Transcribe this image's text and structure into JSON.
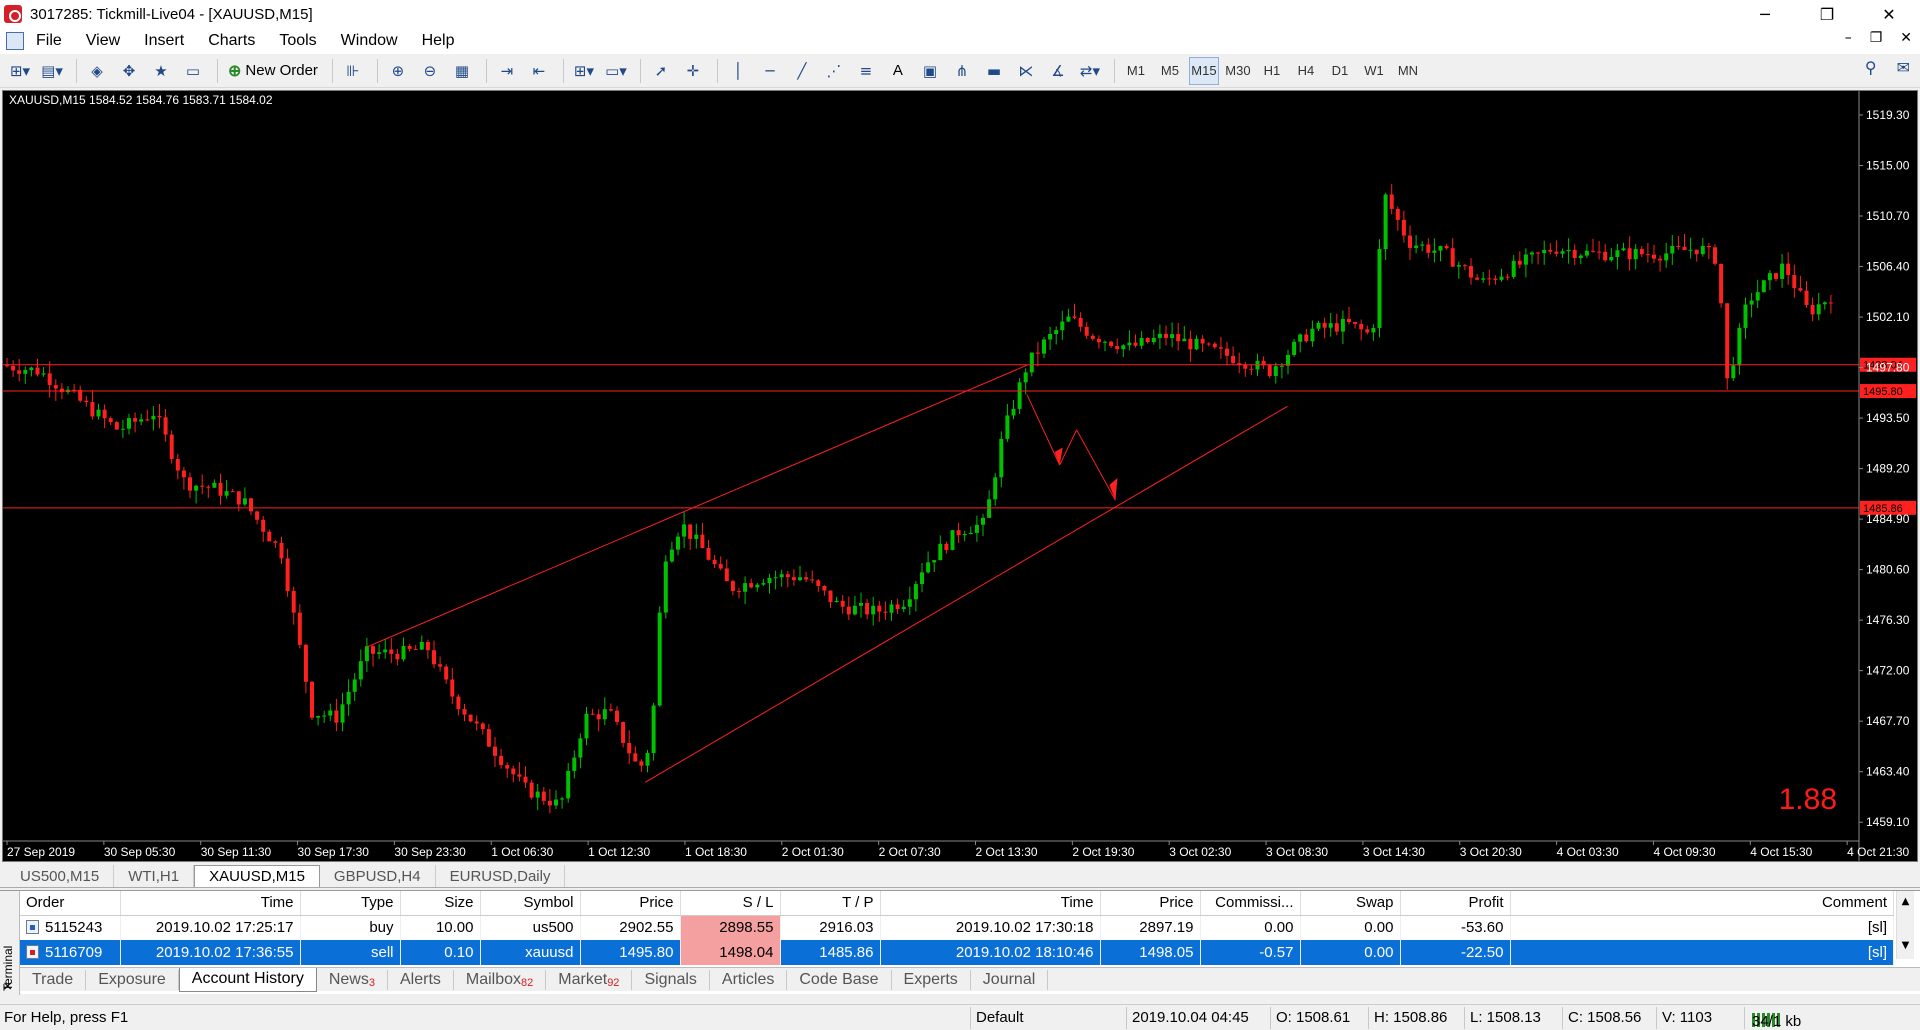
{
  "window": {
    "title": "3017285: Tickmill-Live04 - [XAUUSD,M15]",
    "controls": [
      "─",
      "❐",
      "✕"
    ]
  },
  "menu": {
    "items": [
      "File",
      "View",
      "Insert",
      "Charts",
      "Tools",
      "Window",
      "Help"
    ],
    "mdi_controls": [
      "–",
      "❐",
      "✕"
    ]
  },
  "toolbar": {
    "new_order_label": "New Order",
    "text_tool_label": "A",
    "timeframes": [
      "M1",
      "M5",
      "M15",
      "M30",
      "H1",
      "H4",
      "D1",
      "W1",
      "MN"
    ],
    "active_timeframe": "M15"
  },
  "chart": {
    "ohlc_label": "XAUUSD,M15  1584.52 1584.76 1583.71 1584.02",
    "big_value": "1.88",
    "price_scale": [
      "1519.30",
      "1515.00",
      "1510.70",
      "1506.40",
      "1502.10",
      "1497.80",
      "1493.50",
      "1489.20",
      "1484.90",
      "1480.60",
      "1476.30",
      "1472.00",
      "1467.70",
      "1463.40",
      "1459.10"
    ],
    "time_scale": [
      "27 Sep 2019",
      "30 Sep 05:30",
      "30 Sep 11:30",
      "30 Sep 17:30",
      "30 Sep 23:30",
      "1 Oct 06:30",
      "1 Oct 12:30",
      "1 Oct 18:30",
      "2 Oct 01:30",
      "2 Oct 07:30",
      "2 Oct 13:30",
      "2 Oct 19:30",
      "3 Oct 02:30",
      "3 Oct 08:30",
      "3 Oct 14:30",
      "3 Oct 20:30",
      "4 Oct 03:30",
      "4 Oct 09:30",
      "4 Oct 15:30",
      "4 Oct 21:30"
    ],
    "level_labels": [
      {
        "price": 1498.04,
        "text": "1498.04"
      },
      {
        "price": 1495.8,
        "text": "1495.80"
      },
      {
        "price": 1485.86,
        "text": "1485.86"
      }
    ],
    "colors": {
      "bull": "#00c000",
      "bear": "#ff2020",
      "lines": "#ff2020",
      "background": "#000000",
      "axis_text": "#ffffff"
    }
  },
  "chart_data": {
    "type": "candlestick",
    "symbol": "XAUUSD",
    "timeframe": "M15",
    "ylim": [
      1457.5,
      1521.0
    ],
    "path_points": [
      [
        0,
        1498.0
      ],
      [
        30,
        1497.5
      ],
      [
        55,
        1495.6
      ],
      [
        95,
        1492.5
      ],
      [
        125,
        1494.0
      ],
      [
        150,
        1488.0
      ],
      [
        175,
        1487.5
      ],
      [
        198,
        1486.5
      ],
      [
        230,
        1482.0
      ],
      [
        255,
        1468.5
      ],
      [
        275,
        1468.0
      ],
      [
        300,
        1473.5
      ],
      [
        330,
        1473.5
      ],
      [
        350,
        1474.0
      ],
      [
        370,
        1470.0
      ],
      [
        400,
        1466.0
      ],
      [
        430,
        1462.0
      ],
      [
        460,
        1460.5
      ],
      [
        480,
        1468.0
      ],
      [
        500,
        1468.5
      ],
      [
        525,
        1463.5
      ],
      [
        535,
        1466.0
      ],
      [
        545,
        1481.5
      ],
      [
        560,
        1484.5
      ],
      [
        580,
        1482.0
      ],
      [
        600,
        1479.0
      ],
      [
        630,
        1480.0
      ],
      [
        660,
        1480.0
      ],
      [
        690,
        1477.5
      ],
      [
        720,
        1477.0
      ],
      [
        745,
        1478.0
      ],
      [
        760,
        1481.0
      ],
      [
        790,
        1484.0
      ],
      [
        810,
        1484.5
      ],
      [
        825,
        1492.0
      ],
      [
        845,
        1498.0
      ],
      [
        860,
        1500.0
      ],
      [
        880,
        1502.0
      ],
      [
        900,
        1500.5
      ],
      [
        930,
        1499.5
      ],
      [
        960,
        1500.5
      ],
      [
        990,
        1499.5
      ],
      [
        1020,
        1498.5
      ],
      [
        1045,
        1497.5
      ],
      [
        1060,
        1499.0
      ],
      [
        1080,
        1501.0
      ],
      [
        1110,
        1501.5
      ],
      [
        1130,
        1500.5
      ],
      [
        1140,
        1512.5
      ],
      [
        1160,
        1508.5
      ],
      [
        1190,
        1507.5
      ],
      [
        1220,
        1505.0
      ],
      [
        1250,
        1506.5
      ],
      [
        1280,
        1508.0
      ],
      [
        1310,
        1507.5
      ],
      [
        1340,
        1507.5
      ],
      [
        1370,
        1507.5
      ],
      [
        1400,
        1508.0
      ],
      [
        1415,
        1507.0
      ],
      [
        1423,
        1496.5
      ],
      [
        1440,
        1503.5
      ],
      [
        1470,
        1506.5
      ],
      [
        1490,
        1502.5
      ],
      [
        1510,
        1504.0
      ]
    ]
  },
  "symbol_tabs": {
    "tabs": [
      "US500,M15",
      "WTI,H1",
      "XAUUSD,M15",
      "GBPUSD,H4",
      "EURUSD,Daily"
    ],
    "active_index": 2
  },
  "terminal": {
    "side_label": "Terminal",
    "columns": [
      "Order",
      "Time",
      "Type",
      "Size",
      "Symbol",
      "Price",
      "S / L",
      "T / P",
      "Time",
      "Price",
      "Commissi...",
      "Swap",
      "Profit",
      "Comment"
    ],
    "rows": [
      {
        "order": "5115243",
        "open_time": "2019.10.02 17:25:17",
        "type": "buy",
        "size": "10.00",
        "symbol": "us500",
        "price": "2902.55",
        "sl": "2898.55",
        "tp": "2916.03",
        "close_time": "2019.10.02 17:30:18",
        "close_price": "2897.19",
        "commission": "0.00",
        "swap": "0.00",
        "profit": "-53.60",
        "comment": "[sl]"
      },
      {
        "order": "5116709",
        "open_time": "2019.10.02 17:36:55",
        "type": "sell",
        "size": "0.10",
        "symbol": "xauusd",
        "price": "1495.80",
        "sl": "1498.04",
        "tp": "1485.86",
        "close_time": "2019.10.02 18:10:46",
        "close_price": "1498.05",
        "commission": "-0.57",
        "swap": "0.00",
        "profit": "-22.50",
        "comment": "[sl]"
      }
    ],
    "tabs": [
      {
        "label": "Trade",
        "badge": ""
      },
      {
        "label": "Exposure",
        "badge": ""
      },
      {
        "label": "Account History",
        "badge": ""
      },
      {
        "label": "News",
        "badge": "3"
      },
      {
        "label": "Alerts",
        "badge": ""
      },
      {
        "label": "Mailbox",
        "badge": "82"
      },
      {
        "label": "Market",
        "badge": "92"
      },
      {
        "label": "Signals",
        "badge": ""
      },
      {
        "label": "Articles",
        "badge": ""
      },
      {
        "label": "Code Base",
        "badge": ""
      },
      {
        "label": "Experts",
        "badge": ""
      },
      {
        "label": "Journal",
        "badge": ""
      }
    ],
    "active_tab": "Account History"
  },
  "status": {
    "help": "For Help, press F1",
    "profile": "Default",
    "datetime": "2019.10.04 04:45",
    "open": "O: 1508.61",
    "high": "H: 1508.86",
    "low": "L: 1508.13",
    "close": "C: 1508.56",
    "volume": "V: 1103",
    "traffic": "34/1 kb"
  }
}
